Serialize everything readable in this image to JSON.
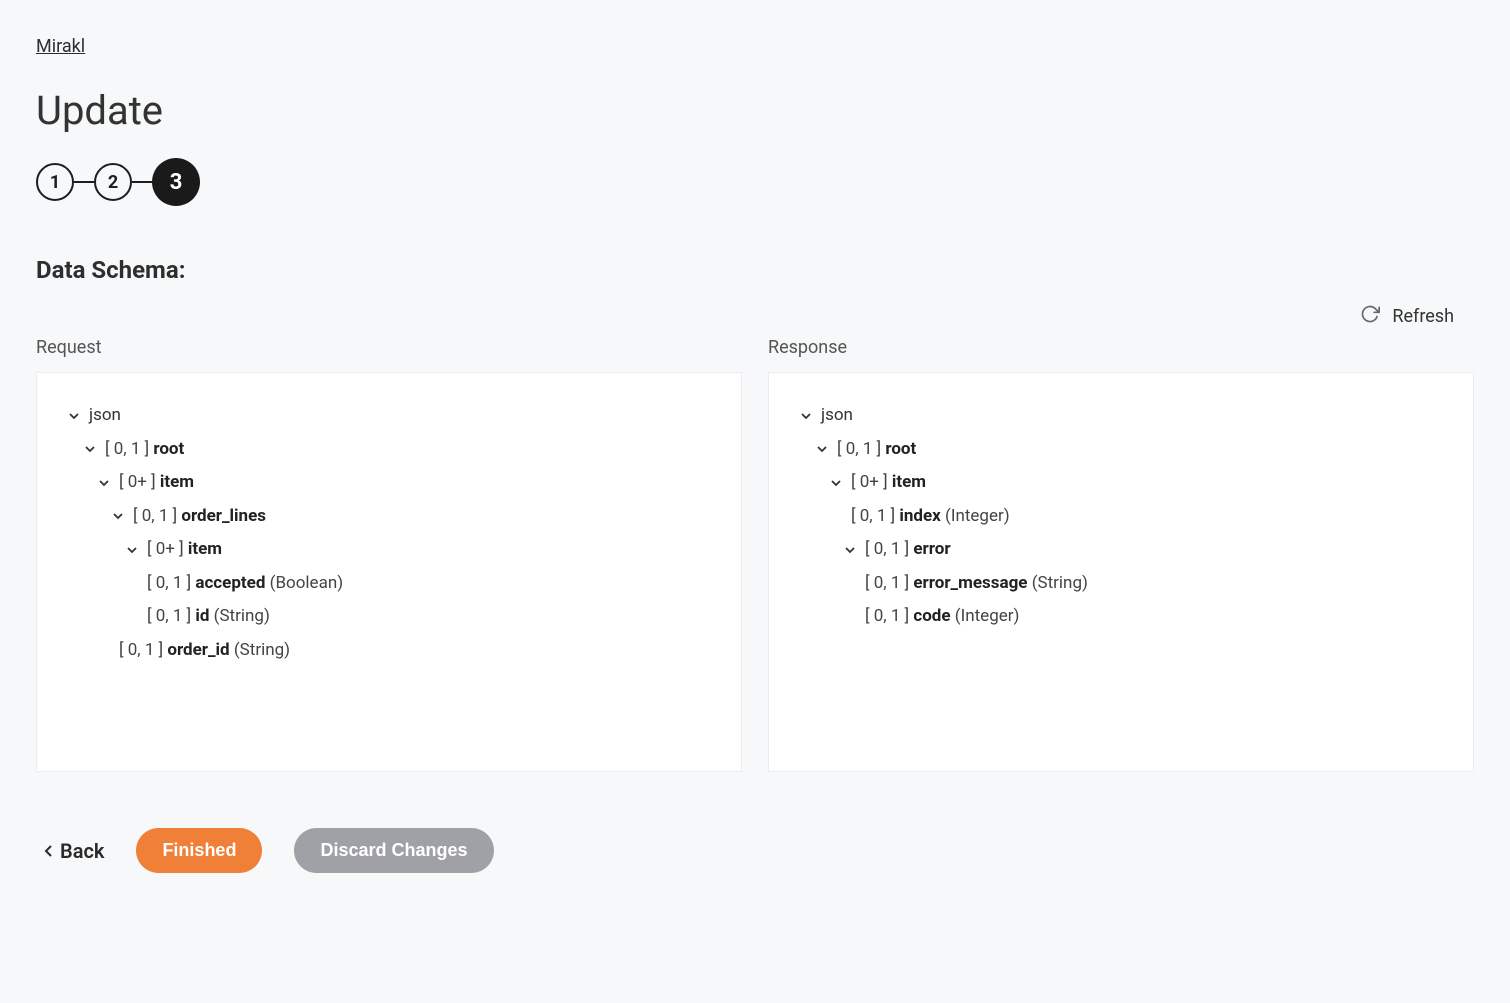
{
  "breadcrumb": {
    "label": "Mirakl"
  },
  "title": "Update",
  "stepper": {
    "steps": [
      "1",
      "2",
      "3"
    ],
    "current": 3
  },
  "section": {
    "heading": "Data Schema:"
  },
  "refresh": {
    "label": "Refresh"
  },
  "request": {
    "label": "Request",
    "tree": {
      "root_label": "json",
      "n0": {
        "card": "[ 0, 1 ]",
        "name": "root"
      },
      "n1": {
        "card": "[ 0+ ]",
        "name": "item"
      },
      "n2": {
        "card": "[ 0, 1 ]",
        "name": "order_lines"
      },
      "n3": {
        "card": "[ 0+ ]",
        "name": "item"
      },
      "n4": {
        "card": "[ 0, 1 ]",
        "name": "accepted",
        "type": "(Boolean)"
      },
      "n5": {
        "card": "[ 0, 1 ]",
        "name": "id",
        "type": "(String)"
      },
      "n6": {
        "card": "[ 0, 1 ]",
        "name": "order_id",
        "type": "(String)"
      }
    }
  },
  "response": {
    "label": "Response",
    "tree": {
      "root_label": "json",
      "n0": {
        "card": "[ 0, 1 ]",
        "name": "root"
      },
      "n1": {
        "card": "[ 0+ ]",
        "name": "item"
      },
      "n2": {
        "card": "[ 0, 1 ]",
        "name": "index",
        "type": "(Integer)"
      },
      "n3": {
        "card": "[ 0, 1 ]",
        "name": "error"
      },
      "n4": {
        "card": "[ 0, 1 ]",
        "name": "error_message",
        "type": "(String)"
      },
      "n5": {
        "card": "[ 0, 1 ]",
        "name": "code",
        "type": "(Integer)"
      }
    }
  },
  "footer": {
    "back": "Back",
    "finished": "Finished",
    "discard": "Discard Changes"
  }
}
